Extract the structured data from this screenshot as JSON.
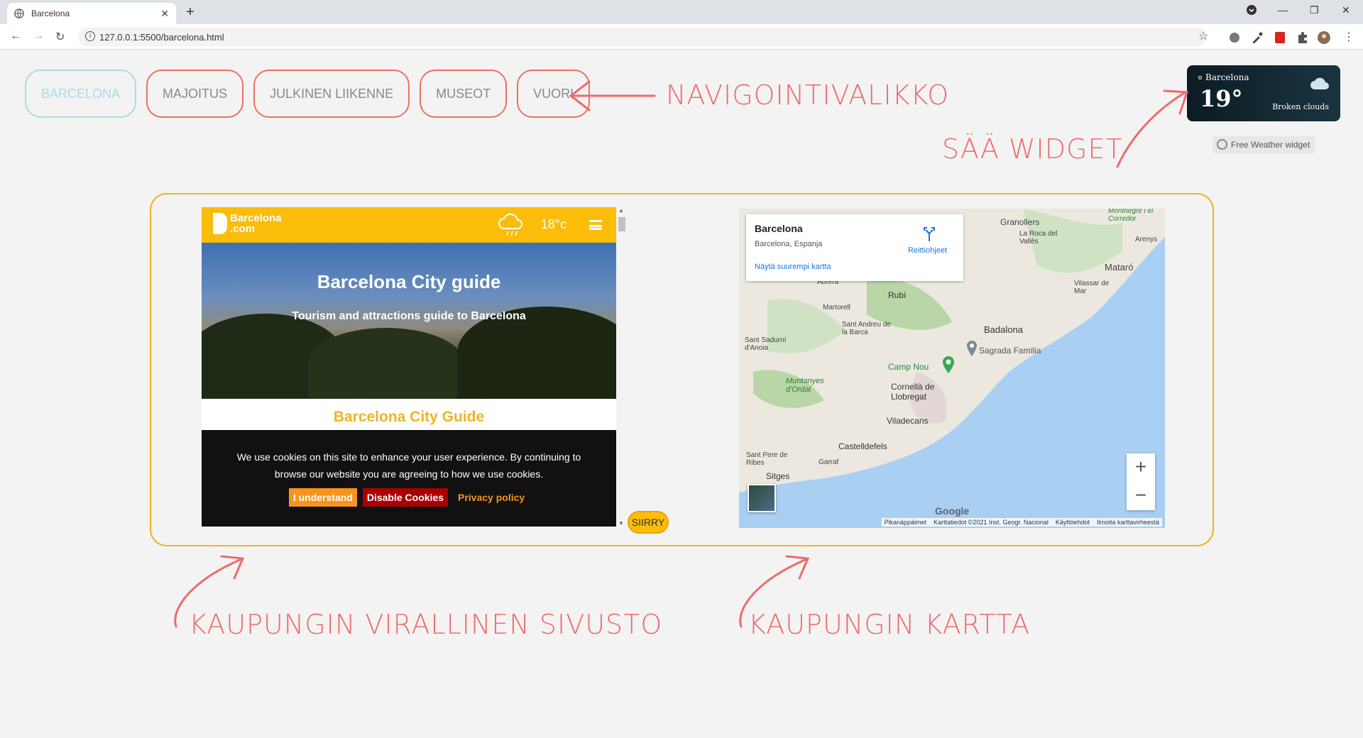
{
  "browser": {
    "tab_title": "Barcelona",
    "url": "127.0.0.1:5500/barcelona.html",
    "new_tab": "+",
    "close": "✕"
  },
  "nav": {
    "items": [
      "BARCELONA",
      "MAJOITUS",
      "JULKINEN LIIKENNE",
      "MUSEOT",
      "VUORI"
    ],
    "active_index": 0,
    "accent": "#e9735f",
    "active_color": "#a8dce4"
  },
  "annotations": {
    "nav": "NAVIGOINTIVALIKKO",
    "weather": "SÄÄ WIDGET",
    "site": "KAUPUNGIN VIRALLINEN SIVUSTO",
    "map": "KAUPUNGIN KARTTA",
    "color": "#ef6b6b"
  },
  "weather": {
    "city": "Barcelona",
    "temp": "19°",
    "condition": "Broken clouds",
    "widget_link": "Free Weather widget"
  },
  "site": {
    "logo_line1": "Barcelona",
    "logo_line2": ".com",
    "temp": "18°c",
    "hero_title": "Barcelona City guide",
    "hero_subtitle": "Tourism and attractions guide to Barcelona",
    "section_title": "Barcelona City Guide",
    "cookie_text_1": "We use cookies on this site to enhance your user experience. By continuing to",
    "cookie_text_2": "browse our website you are agreeing to how we use cookies.",
    "btn_understand": "I understand",
    "btn_disable": "Disable Cookies",
    "btn_privacy": "Privacy policy",
    "brand_color": "#fbbd0a"
  },
  "siirry": "SIIRRY",
  "map": {
    "place_title": "Barcelona",
    "place_sub": "Barcelona, Espanja",
    "larger_map": "Näytä suurempi kartta",
    "directions": "Reittiohjeet",
    "zoom_in": "+",
    "zoom_out": "−",
    "google": "Google",
    "footer": [
      "Pikanäppäimet",
      "Karttatiedot ©2021 Inst. Geogr. Nacional",
      "Käyttöehdot",
      "Ilmoita karttavirheestä"
    ],
    "labels": [
      "Granollers",
      "La Roca del Vallès",
      "Mataró",
      "Vilassar de Mar",
      "Badalona",
      "Sagrada Familia",
      "Camp Nou",
      "Cornellà de Llobregat",
      "Viladecans",
      "Castelldefels",
      "Sant Pere de Ribes",
      "Sitges",
      "Garraf",
      "Martorell",
      "Rubí",
      "Sant Andreu de la Barca",
      "Sant Sadurní d'Anoia",
      "Muntanyes d'Ordal",
      "Montnegre i el Corredor",
      "Arenys",
      "Abrera"
    ]
  }
}
